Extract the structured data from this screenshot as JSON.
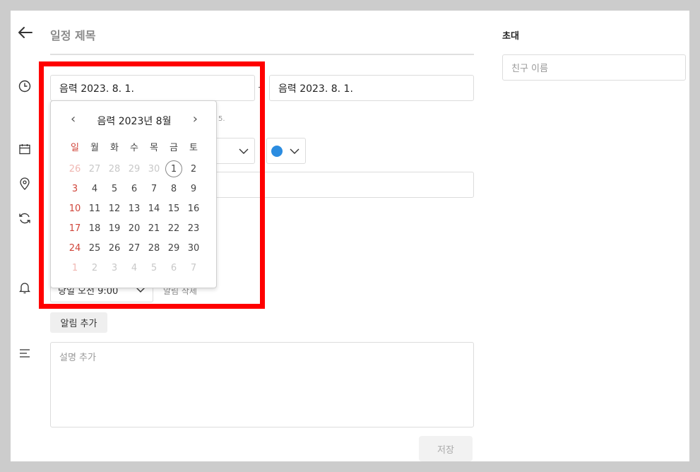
{
  "header": {
    "title": "일정 제목"
  },
  "schedule": {
    "start_date": "음력 2023. 8. 1.",
    "end_date": "음력 2023. 8. 1.",
    "lunar_hint": "5."
  },
  "alarm": {
    "time_value": "당일 오전 9:00",
    "delete_label": "알림 삭제",
    "add_label": "알림 추가"
  },
  "description": {
    "placeholder": "설명 추가"
  },
  "footer": {
    "save_label": "저장"
  },
  "invite": {
    "title": "초대",
    "placeholder": "친구 이름"
  },
  "datepicker": {
    "month_label": "음력 2023년 8월",
    "prev_glyph": "‹",
    "next_glyph": "›",
    "weekdays": [
      "일",
      "월",
      "화",
      "수",
      "목",
      "금",
      "토"
    ],
    "weeks": [
      [
        "26",
        "27",
        "28",
        "29",
        "30",
        "1",
        "2"
      ],
      [
        "3",
        "4",
        "5",
        "6",
        "7",
        "8",
        "9"
      ],
      [
        "10",
        "11",
        "12",
        "13",
        "14",
        "15",
        "16"
      ],
      [
        "17",
        "18",
        "19",
        "20",
        "21",
        "22",
        "23"
      ],
      [
        "24",
        "25",
        "26",
        "27",
        "28",
        "29",
        "30"
      ],
      [
        "1",
        "2",
        "3",
        "4",
        "5",
        "6",
        "7"
      ]
    ],
    "selected_day": "1"
  },
  "colors": {
    "event_color": "#2b8ce0",
    "highlight": "#ff0000",
    "sunday": "#d0453a"
  },
  "icons": {
    "back": "arrow-left-icon",
    "time": "clock-icon",
    "calendar": "calendar-icon",
    "location": "location-pin-icon",
    "repeat": "repeat-icon",
    "alarm": "bell-icon",
    "description": "text-lines-icon"
  }
}
